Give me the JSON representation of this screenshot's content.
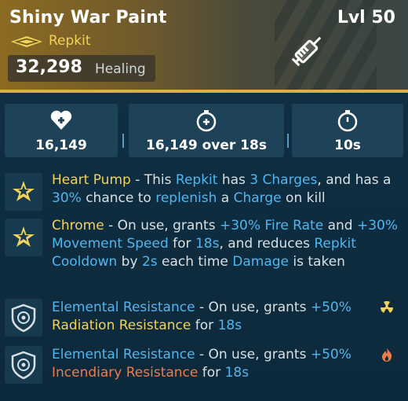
{
  "item": {
    "name": "Shiny War Paint",
    "level": "Lvl 50",
    "type": "Repkit",
    "primary_value": "32,298",
    "primary_label": "Healing",
    "accent_color": "#f2d25a"
  },
  "stats": [
    {
      "icon": "heart-plus-icon",
      "value": "16,149"
    },
    {
      "icon": "stopwatch-plus-icon",
      "value": "16,149 over 18s"
    },
    {
      "icon": "stopwatch-icon",
      "value": "10s"
    }
  ],
  "perks": [
    {
      "icon": "star-badge-icon",
      "name": "Heart Pump",
      "d1": " - This ",
      "k1": "Repkit",
      "d2": " has ",
      "k2": "3 Charges",
      "d3": ", and has a ",
      "k3": "30%",
      "d4": " chance to ",
      "k4": "replenish",
      "d5": " a ",
      "k5": "Charge",
      "d6": " on kill"
    },
    {
      "icon": "star-badge-icon",
      "name": "Chrome",
      "d1": " - On use, grants ",
      "k1": "+30% Fire Rate",
      "d2": " and ",
      "k2": "+30% Movement Speed",
      "d3": " for ",
      "k3": "18s",
      "d4": ", and reduces ",
      "k4": "Repkit Cooldown",
      "d5": " by ",
      "k5": "2s",
      "d6": " each time ",
      "k6": "Damage",
      "d7": " is taken"
    },
    {
      "icon": "shield-icon",
      "name": "Elemental Resistance",
      "d1": " - On use, grants ",
      "k1": "+50%",
      "k2": "Radiation Resistance",
      "d2": " for ",
      "k3": "18s",
      "element_icon": "radiation-icon"
    },
    {
      "icon": "shield-icon",
      "name": "Elemental Resistance",
      "d1": " - On use, grants ",
      "k1": "+50%",
      "k2": "Incendiary Resistance",
      "d2": " for ",
      "k3": "18s",
      "element_icon": "flame-icon"
    }
  ]
}
